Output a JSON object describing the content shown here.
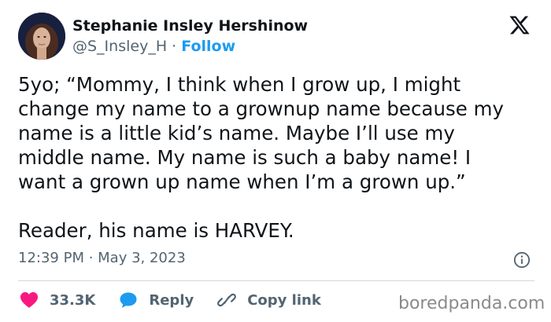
{
  "author": {
    "display_name": "Stephanie Insley Hershinow",
    "handle": "@S_Insley_H",
    "separator": "·",
    "follow_label": "Follow"
  },
  "tweet": {
    "lines": [
      "5yo; “Mommy, I think when I grow up, I might",
      "change my name to a grownup name because my",
      "name is a little kid’s name. Maybe I’ll use my",
      "middle name. My name is such a baby name! I",
      "want a grown up name when I’m a grown up.”",
      "Reader, his name is HARVEY."
    ],
    "timestamp": "12:39 PM · May 3, 2023"
  },
  "actions": {
    "likes_count": "33.3K",
    "reply_label": "Reply",
    "copy_link_label": "Copy link"
  },
  "watermark": "boredpanda.com",
  "colors": {
    "like": "#f91880",
    "reply": "#1d9bf0",
    "follow": "#1d9bf0",
    "muted": "#536471"
  },
  "icons": [
    "x-logo-icon",
    "info-icon",
    "heart-icon",
    "reply-bubble-icon",
    "link-icon"
  ]
}
